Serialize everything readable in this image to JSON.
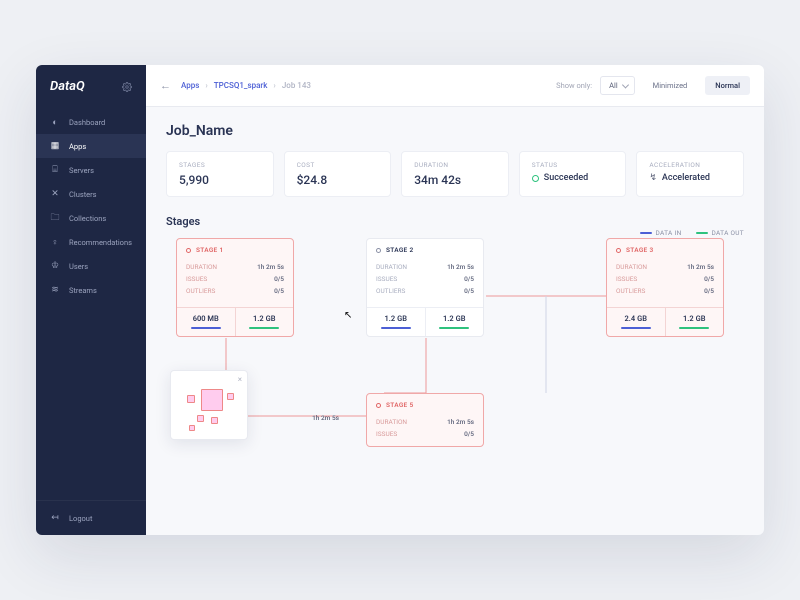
{
  "brand": "DataQ",
  "sidebar": {
    "items": [
      {
        "label": "Dashboard"
      },
      {
        "label": "Apps"
      },
      {
        "label": "Servers"
      },
      {
        "label": "Clusters"
      },
      {
        "label": "Collections"
      },
      {
        "label": "Recommendations"
      },
      {
        "label": "Users"
      },
      {
        "label": "Streams"
      }
    ],
    "logout": "Logout"
  },
  "topbar": {
    "crumbs": [
      "Apps",
      "TPCSQ1_spark",
      "Job 143"
    ],
    "show_only": "Show only:",
    "filter": "All",
    "view_min": "Minimized",
    "view_norm": "Normal"
  },
  "page_title": "Job_Name",
  "stats": [
    {
      "label": "STAGES",
      "value": "5,990"
    },
    {
      "label": "COST",
      "value": "$24.8"
    },
    {
      "label": "DURATION",
      "value": "34m 42s"
    },
    {
      "label": "STATUS",
      "value": "Succeeded",
      "kind": "status"
    },
    {
      "label": "ACCELERATION",
      "value": "Accelerated",
      "kind": "accel"
    }
  ],
  "stages_heading": "Stages",
  "legend": {
    "in": "DATA IN",
    "out": "DATA OUT"
  },
  "stages": [
    {
      "id": "STAGE 1",
      "red": true,
      "duration": "1h 2m 5s",
      "issues": "0/5",
      "outliers": "0/5",
      "in": "600 MB",
      "out": "1.2 GB"
    },
    {
      "id": "STAGE 2",
      "red": false,
      "duration": "1h 2m 5s",
      "issues": "0/5",
      "outliers": "0/5",
      "in": "1.2 GB",
      "out": "1.2 GB"
    },
    {
      "id": "STAGE 3",
      "red": true,
      "duration": "1h 2m 5s",
      "issues": "0/5",
      "outliers": "0/5",
      "in": "2.4 GB",
      "out": "1.2 GB"
    },
    {
      "id": "STAGE 5",
      "red": true,
      "duration": "1h 2m 5s",
      "issues": "0/5",
      "outliers": "",
      "in": "",
      "out": ""
    }
  ],
  "row_labels": {
    "duration": "DURATION",
    "issues": "ISSUES",
    "outliers": "OUTLIERS"
  },
  "partial": {
    "dur": "1h 2m 5s"
  }
}
